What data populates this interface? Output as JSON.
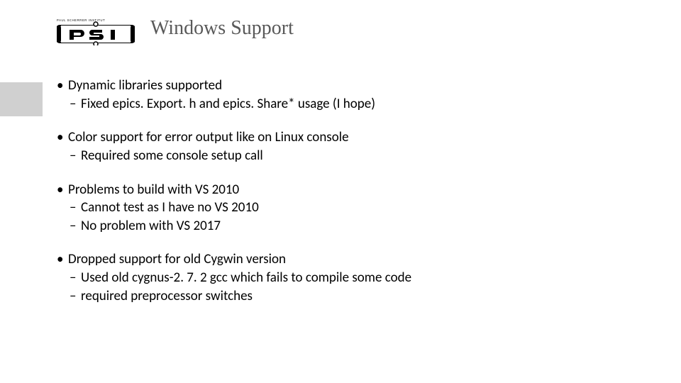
{
  "logo": {
    "top_text": "PAUL SCHERRER INSTITUT",
    "abbrev": "PSI"
  },
  "title": "Windows Support",
  "bullets": [
    {
      "text": "Dynamic libraries supported",
      "subs": [
        "Fixed epics. Export. h and epics. Share* usage (I hope)"
      ]
    },
    {
      "text": "Color support for error output like on Linux console",
      "subs": [
        "Required some console setup call"
      ]
    },
    {
      "text": "Problems to build with VS 2010",
      "subs": [
        "Cannot test as I have no VS 2010",
        "No problem with VS 2017"
      ]
    },
    {
      "text": "Dropped support for old Cygwin version",
      "subs": [
        "Used old cygnus-2. 7. 2 gcc which fails to compile some code",
        "required preprocessor switches"
      ]
    }
  ]
}
